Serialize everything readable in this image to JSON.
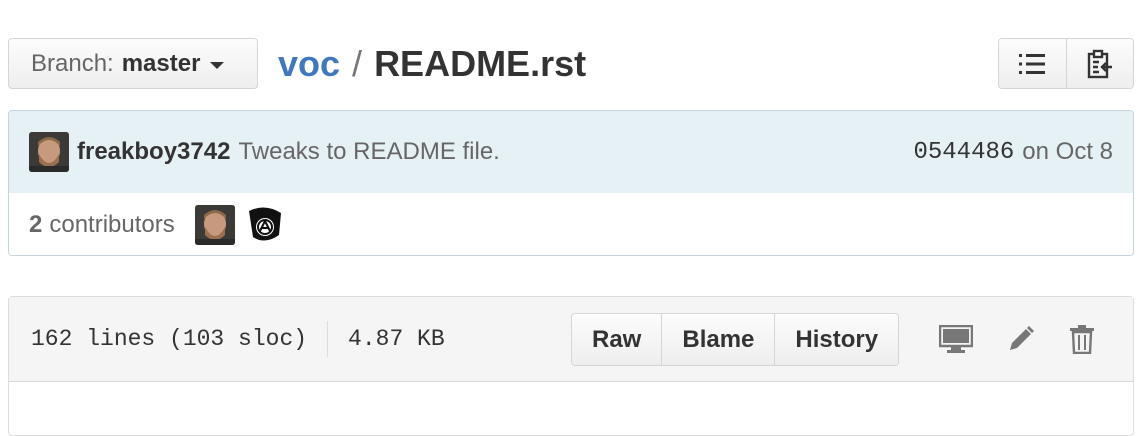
{
  "branch": {
    "label": "Branch:",
    "value": "master"
  },
  "breadcrumb": {
    "repo": "voc",
    "separator": "/",
    "file": "README.rst"
  },
  "header_buttons": {
    "list_icon": "list-icon",
    "clipboard_icon": "clipboard-icon"
  },
  "commit": {
    "author": "freakboy3742",
    "message": "Tweaks to README file.",
    "sha": "0544486",
    "date": "on Oct 8"
  },
  "contributors": {
    "count": "2",
    "label": "contributors"
  },
  "file": {
    "lines": "162 lines (103 sloc)",
    "size": "4.87 KB",
    "buttons": {
      "raw": "Raw",
      "blame": "Blame",
      "history": "History"
    },
    "icons": [
      "desktop-icon",
      "pencil-icon",
      "trash-icon"
    ]
  },
  "colors": {
    "link": "#4078c0",
    "commit_bg": "#e6f1f6",
    "border": "#c5d5dd"
  }
}
